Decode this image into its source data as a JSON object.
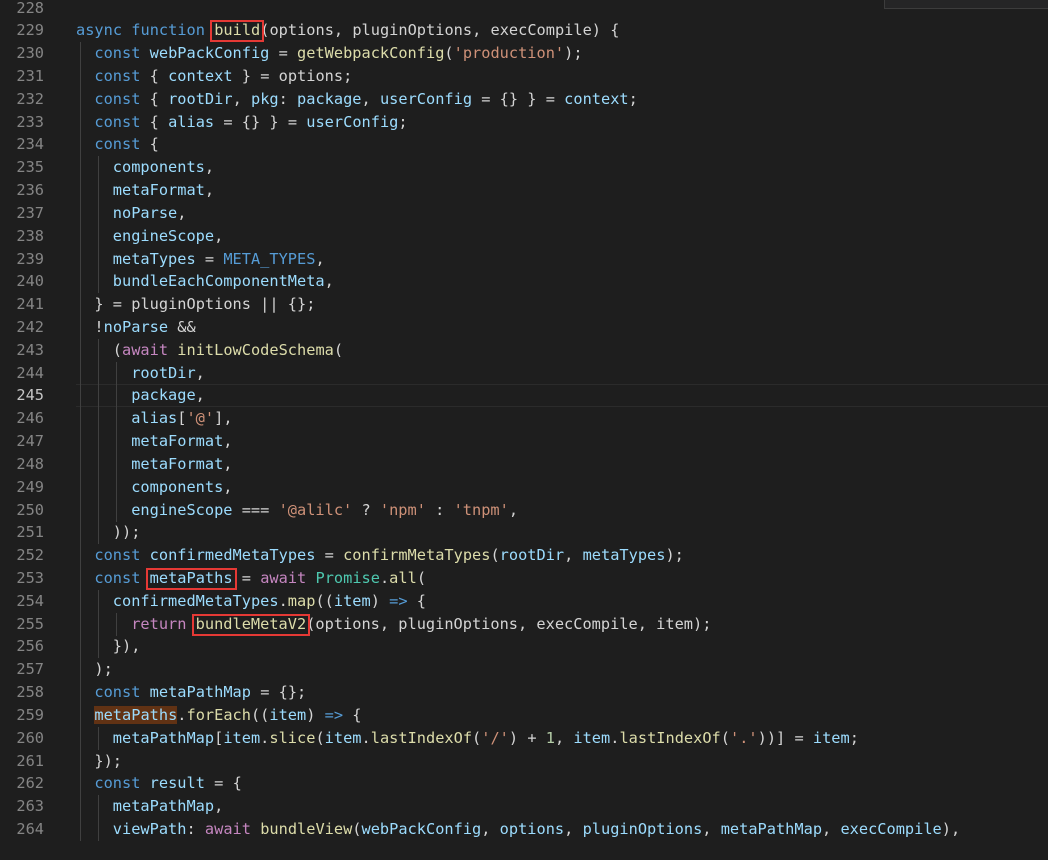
{
  "editor": {
    "language": "javascript",
    "active_line": "245",
    "colors": {
      "background": "#1e1e1e",
      "line_number": "#858585",
      "keyword": "#569cd6",
      "control": "#c586c0",
      "function": "#dcdcaa",
      "variable": "#9cdcfe",
      "string": "#ce9178",
      "type": "#4ec9b0",
      "number": "#b5cea8",
      "plain": "#d4d4d4",
      "annotation_box": "#e53935",
      "selection_highlight": "#613214"
    },
    "lines": [
      {
        "num": "228",
        "indent": 0,
        "tokens": []
      },
      {
        "num": "229",
        "indent": 0,
        "tokens": [
          [
            "k",
            "async"
          ],
          [
            "p",
            " "
          ],
          [
            "k",
            "function"
          ],
          [
            "p",
            " "
          ],
          [
            "f",
            "build"
          ],
          [
            "p",
            "(options, pluginOptions, execCompile) {"
          ]
        ]
      },
      {
        "num": "230",
        "indent": 1,
        "tokens": [
          [
            "k",
            "const"
          ],
          [
            "p",
            " "
          ],
          [
            "v",
            "webPackConfig"
          ],
          [
            "p",
            " = "
          ],
          [
            "f",
            "getWebpackConfig"
          ],
          [
            "p",
            "("
          ],
          [
            "s",
            "'production'"
          ],
          [
            "p",
            ");"
          ]
        ]
      },
      {
        "num": "231",
        "indent": 1,
        "tokens": [
          [
            "k",
            "const"
          ],
          [
            "p",
            " { "
          ],
          [
            "v",
            "context"
          ],
          [
            "p",
            " } = options;"
          ]
        ]
      },
      {
        "num": "232",
        "indent": 1,
        "tokens": [
          [
            "k",
            "const"
          ],
          [
            "p",
            " { "
          ],
          [
            "v",
            "rootDir"
          ],
          [
            "p",
            ", "
          ],
          [
            "v",
            "pkg"
          ],
          [
            "p",
            ": "
          ],
          [
            "v",
            "package"
          ],
          [
            "p",
            ", "
          ],
          [
            "v",
            "userConfig"
          ],
          [
            "p",
            " = {} } = "
          ],
          [
            "v",
            "context"
          ],
          [
            "p",
            ";"
          ]
        ]
      },
      {
        "num": "233",
        "indent": 1,
        "tokens": [
          [
            "k",
            "const"
          ],
          [
            "p",
            " { "
          ],
          [
            "v",
            "alias"
          ],
          [
            "p",
            " = {} } = "
          ],
          [
            "v",
            "userConfig"
          ],
          [
            "p",
            ";"
          ]
        ]
      },
      {
        "num": "234",
        "indent": 1,
        "tokens": [
          [
            "k",
            "const"
          ],
          [
            "p",
            " {"
          ]
        ]
      },
      {
        "num": "235",
        "indent": 2,
        "tokens": [
          [
            "v",
            "components"
          ],
          [
            "p",
            ","
          ]
        ]
      },
      {
        "num": "236",
        "indent": 2,
        "tokens": [
          [
            "v",
            "metaFormat"
          ],
          [
            "p",
            ","
          ]
        ]
      },
      {
        "num": "237",
        "indent": 2,
        "tokens": [
          [
            "v",
            "noParse"
          ],
          [
            "p",
            ","
          ]
        ]
      },
      {
        "num": "238",
        "indent": 2,
        "tokens": [
          [
            "v",
            "engineScope"
          ],
          [
            "p",
            ","
          ]
        ]
      },
      {
        "num": "239",
        "indent": 2,
        "tokens": [
          [
            "v",
            "metaTypes"
          ],
          [
            "p",
            " = "
          ],
          [
            "k",
            "META_TYPES"
          ],
          [
            "p",
            ","
          ]
        ]
      },
      {
        "num": "240",
        "indent": 2,
        "tokens": [
          [
            "v",
            "bundleEachComponentMeta"
          ],
          [
            "p",
            ","
          ]
        ]
      },
      {
        "num": "241",
        "indent": 1,
        "tokens": [
          [
            "p",
            "} = pluginOptions || {};"
          ]
        ]
      },
      {
        "num": "242",
        "indent": 1,
        "tokens": [
          [
            "p",
            "!"
          ],
          [
            "v",
            "noParse"
          ],
          [
            "p",
            " &&"
          ]
        ]
      },
      {
        "num": "243",
        "indent": 2,
        "tokens": [
          [
            "p",
            "("
          ],
          [
            "c",
            "await"
          ],
          [
            "p",
            " "
          ],
          [
            "f",
            "initLowCodeSchema"
          ],
          [
            "p",
            "("
          ]
        ]
      },
      {
        "num": "244",
        "indent": 3,
        "tokens": [
          [
            "v",
            "rootDir"
          ],
          [
            "p",
            ","
          ]
        ]
      },
      {
        "num": "245",
        "indent": 3,
        "tokens": [
          [
            "v",
            "package"
          ],
          [
            "p",
            ","
          ]
        ]
      },
      {
        "num": "246",
        "indent": 3,
        "tokens": [
          [
            "v",
            "alias"
          ],
          [
            "p",
            "["
          ],
          [
            "s",
            "'@'"
          ],
          [
            "p",
            "],"
          ]
        ]
      },
      {
        "num": "247",
        "indent": 3,
        "tokens": [
          [
            "v",
            "metaFormat"
          ],
          [
            "p",
            ","
          ]
        ]
      },
      {
        "num": "248",
        "indent": 3,
        "tokens": [
          [
            "v",
            "metaFormat"
          ],
          [
            "p",
            ","
          ]
        ]
      },
      {
        "num": "249",
        "indent": 3,
        "tokens": [
          [
            "v",
            "components"
          ],
          [
            "p",
            ","
          ]
        ]
      },
      {
        "num": "250",
        "indent": 3,
        "tokens": [
          [
            "v",
            "engineScope"
          ],
          [
            "p",
            " === "
          ],
          [
            "s",
            "'@alilc'"
          ],
          [
            "p",
            " ? "
          ],
          [
            "s",
            "'npm'"
          ],
          [
            "p",
            " : "
          ],
          [
            "s",
            "'tnpm'"
          ],
          [
            "p",
            ","
          ]
        ]
      },
      {
        "num": "251",
        "indent": 2,
        "tokens": [
          [
            "p",
            "));"
          ]
        ]
      },
      {
        "num": "252",
        "indent": 1,
        "tokens": [
          [
            "k",
            "const"
          ],
          [
            "p",
            " "
          ],
          [
            "v",
            "confirmedMetaTypes"
          ],
          [
            "p",
            " = "
          ],
          [
            "f",
            "confirmMetaTypes"
          ],
          [
            "p",
            "("
          ],
          [
            "v",
            "rootDir"
          ],
          [
            "p",
            ", "
          ],
          [
            "v",
            "metaTypes"
          ],
          [
            "p",
            ");"
          ]
        ]
      },
      {
        "num": "253",
        "indent": 1,
        "tokens": [
          [
            "k",
            "const"
          ],
          [
            "p",
            " "
          ],
          [
            "v",
            "metaPaths"
          ],
          [
            "p",
            " = "
          ],
          [
            "c",
            "await"
          ],
          [
            "p",
            " "
          ],
          [
            "t",
            "Promise"
          ],
          [
            "p",
            "."
          ],
          [
            "f",
            "all"
          ],
          [
            "p",
            "("
          ]
        ]
      },
      {
        "num": "254",
        "indent": 2,
        "tokens": [
          [
            "v",
            "confirmedMetaTypes"
          ],
          [
            "p",
            "."
          ],
          [
            "f",
            "map"
          ],
          [
            "p",
            "(("
          ],
          [
            "v",
            "item"
          ],
          [
            "p",
            ") "
          ],
          [
            "k",
            "=>"
          ],
          [
            "p",
            " {"
          ]
        ]
      },
      {
        "num": "255",
        "indent": 3,
        "tokens": [
          [
            "c",
            "return"
          ],
          [
            "p",
            " "
          ],
          [
            "f",
            "bundleMetaV2"
          ],
          [
            "p",
            "(options, pluginOptions, execCompile, item);"
          ]
        ]
      },
      {
        "num": "256",
        "indent": 2,
        "tokens": [
          [
            "p",
            "}),"
          ]
        ]
      },
      {
        "num": "257",
        "indent": 1,
        "tokens": [
          [
            "p",
            ");"
          ]
        ]
      },
      {
        "num": "258",
        "indent": 1,
        "tokens": [
          [
            "k",
            "const"
          ],
          [
            "p",
            " "
          ],
          [
            "v",
            "metaPathMap"
          ],
          [
            "p",
            " = {};"
          ]
        ]
      },
      {
        "num": "259",
        "indent": 1,
        "tokens": [
          [
            "v",
            "metaPaths"
          ],
          [
            "p",
            "."
          ],
          [
            "f",
            "forEach"
          ],
          [
            "p",
            "(("
          ],
          [
            "v",
            "item"
          ],
          [
            "p",
            ") "
          ],
          [
            "k",
            "=>"
          ],
          [
            "p",
            " {"
          ]
        ]
      },
      {
        "num": "260",
        "indent": 2,
        "tokens": [
          [
            "v",
            "metaPathMap"
          ],
          [
            "p",
            "["
          ],
          [
            "v",
            "item"
          ],
          [
            "p",
            "."
          ],
          [
            "f",
            "slice"
          ],
          [
            "p",
            "("
          ],
          [
            "v",
            "item"
          ],
          [
            "p",
            "."
          ],
          [
            "f",
            "lastIndexOf"
          ],
          [
            "p",
            "("
          ],
          [
            "s",
            "'/'"
          ],
          [
            "p",
            ") + "
          ],
          [
            "n",
            "1"
          ],
          [
            "p",
            ", "
          ],
          [
            "v",
            "item"
          ],
          [
            "p",
            "."
          ],
          [
            "f",
            "lastIndexOf"
          ],
          [
            "p",
            "("
          ],
          [
            "s",
            "'.'"
          ],
          [
            "p",
            "))] = "
          ],
          [
            "v",
            "item"
          ],
          [
            "p",
            ";"
          ]
        ]
      },
      {
        "num": "261",
        "indent": 1,
        "tokens": [
          [
            "p",
            "});"
          ]
        ]
      },
      {
        "num": "262",
        "indent": 1,
        "tokens": [
          [
            "k",
            "const"
          ],
          [
            "p",
            " "
          ],
          [
            "v",
            "result"
          ],
          [
            "p",
            " = {"
          ]
        ]
      },
      {
        "num": "263",
        "indent": 2,
        "tokens": [
          [
            "v",
            "metaPathMap"
          ],
          [
            "p",
            ","
          ]
        ]
      },
      {
        "num": "264",
        "indent": 2,
        "tokens": [
          [
            "v",
            "viewPath"
          ],
          [
            "p",
            ": "
          ],
          [
            "c",
            "await"
          ],
          [
            "p",
            " "
          ],
          [
            "f",
            "bundleView"
          ],
          [
            "p",
            "("
          ],
          [
            "v",
            "webPackConfig"
          ],
          [
            "p",
            ", "
          ],
          [
            "v",
            "options"
          ],
          [
            "p",
            ", "
          ],
          [
            "v",
            "pluginOptions"
          ],
          [
            "p",
            ", "
          ],
          [
            "v",
            "metaPathMap"
          ],
          [
            "p",
            ", "
          ],
          [
            "v",
            "execCompile"
          ],
          [
            "p",
            "),"
          ]
        ]
      }
    ]
  }
}
